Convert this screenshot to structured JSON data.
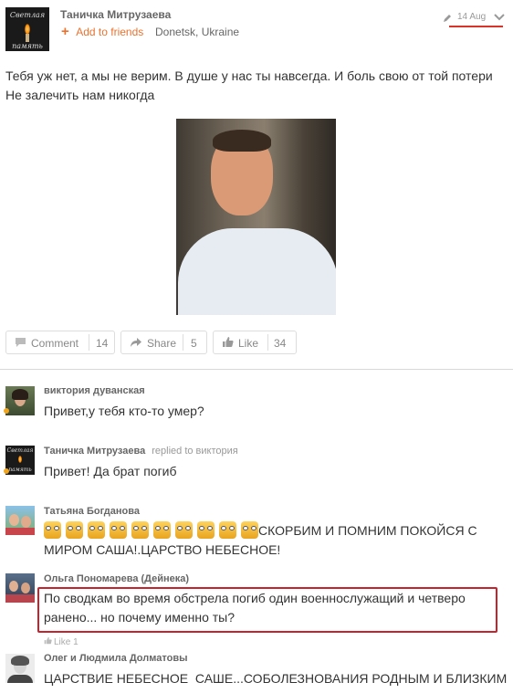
{
  "post": {
    "author": "Таничка Митрузаева",
    "add_friend": "Add to friends",
    "location": "Donetsk, Ukraine",
    "date": "14 Aug",
    "avatar_caption_top": "Светлая",
    "avatar_caption_bottom": "память",
    "text": "Тебя уж нет, а мы не верим. В душе у нас ты навсегда. И боль свою от той потери Не залечить нам никогда",
    "actions": {
      "comment_label": "Comment",
      "comment_count": "14",
      "share_label": "Share",
      "share_count": "5",
      "like_label": "Like",
      "like_count": "34"
    }
  },
  "comments": [
    {
      "author": "виктория дуванская",
      "text": "Привет,у тебя кто-то умер?"
    },
    {
      "author": "Таничка Митрузаева",
      "replied": "replied to виктория",
      "text": "Привет! Да брат погиб"
    },
    {
      "author": "Татьяна Богданова",
      "emoji_count": 10,
      "text_line1": "СКОРБИМ И ПОМНИМ ПОКОЙСЯ С",
      "text_line2": "МИРОМ САША!.ЦАРСТВО НЕБЕСНОЕ!"
    },
    {
      "author": "Ольга Пономарева (Дейнека)",
      "text_line1": "По сводкам во время обстрела погиб один военнослужащий и четверо",
      "text_line2": "ранено... но почему именно ты?",
      "like": "Like 1"
    },
    {
      "author": "Олег и Людмила Долматовы",
      "text": "ЦАРСТВИЕ НЕБЕСНОЕ  САШЕ...СОБОЛЕЗНОВАНИЯ РОДНЫМ И БЛИЗКИМ"
    }
  ],
  "colors": {
    "accent": "#eb722e",
    "highlight": "#d9342b"
  }
}
